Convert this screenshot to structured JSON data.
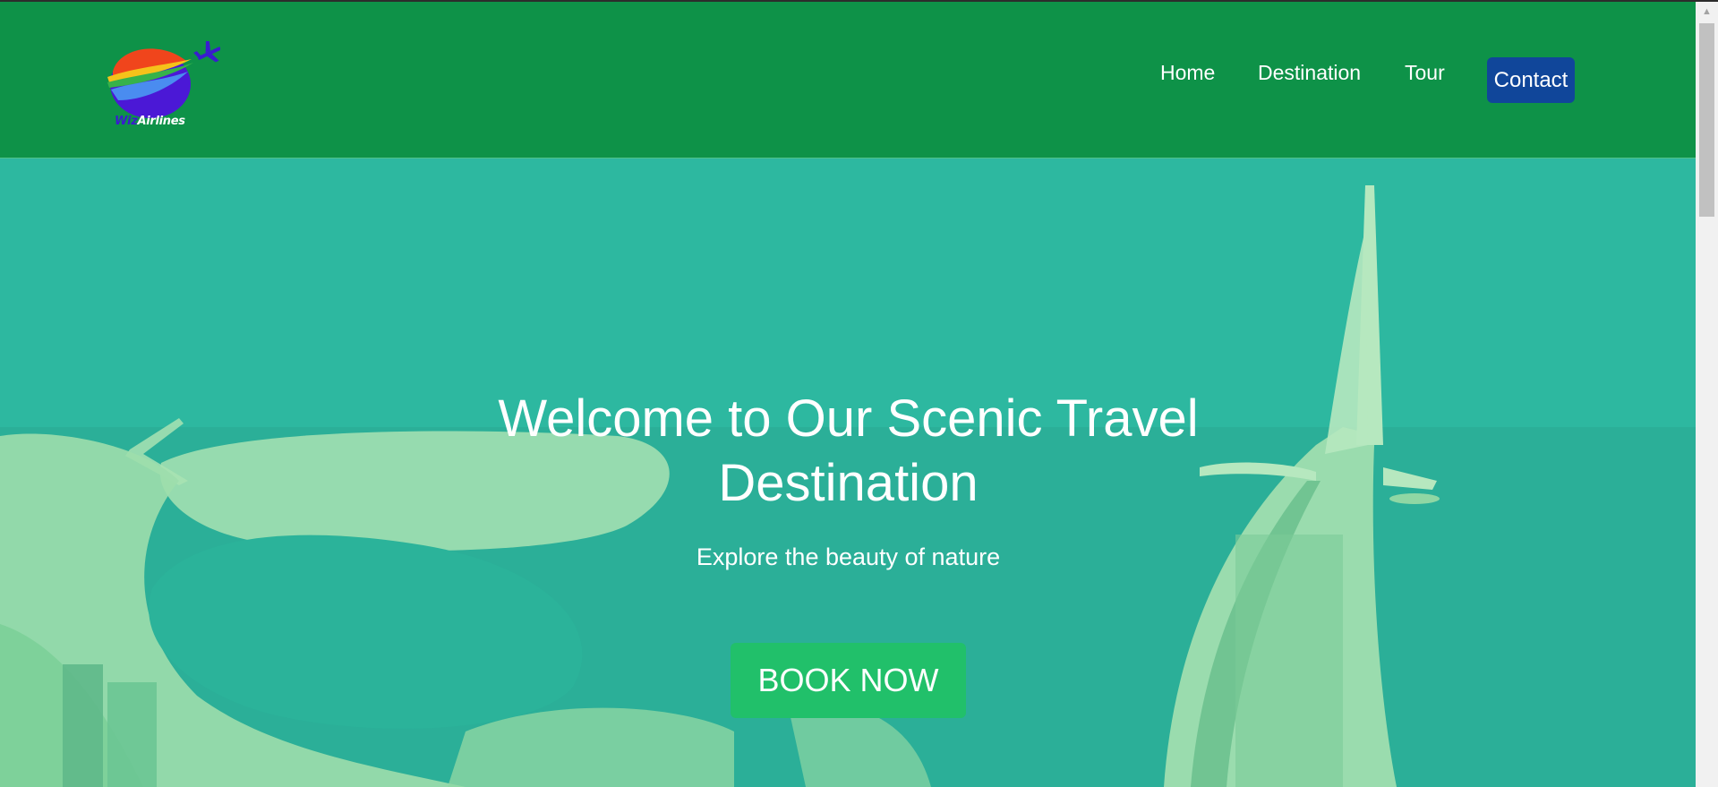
{
  "brand": {
    "logo_text_part1": "Wiz",
    "logo_text_part2": "Airlines"
  },
  "nav": {
    "items": [
      {
        "label": "Home"
      },
      {
        "label": "Destination"
      },
      {
        "label": "Tour"
      }
    ],
    "contact_label": "Contact"
  },
  "hero": {
    "title": "Welcome to Our Scenic Travel Destination",
    "subtitle": "Explore the beauty of nature",
    "cta_label": "BOOK NOW"
  },
  "colors": {
    "header_bg": "#0e9248",
    "contact_bg": "#10469a",
    "cta_bg": "#21c06a",
    "hero_tint": "#2fbfa4"
  },
  "icons": {
    "logo": "globe-airplane-icon",
    "scroll_up": "triangle-up-icon"
  }
}
